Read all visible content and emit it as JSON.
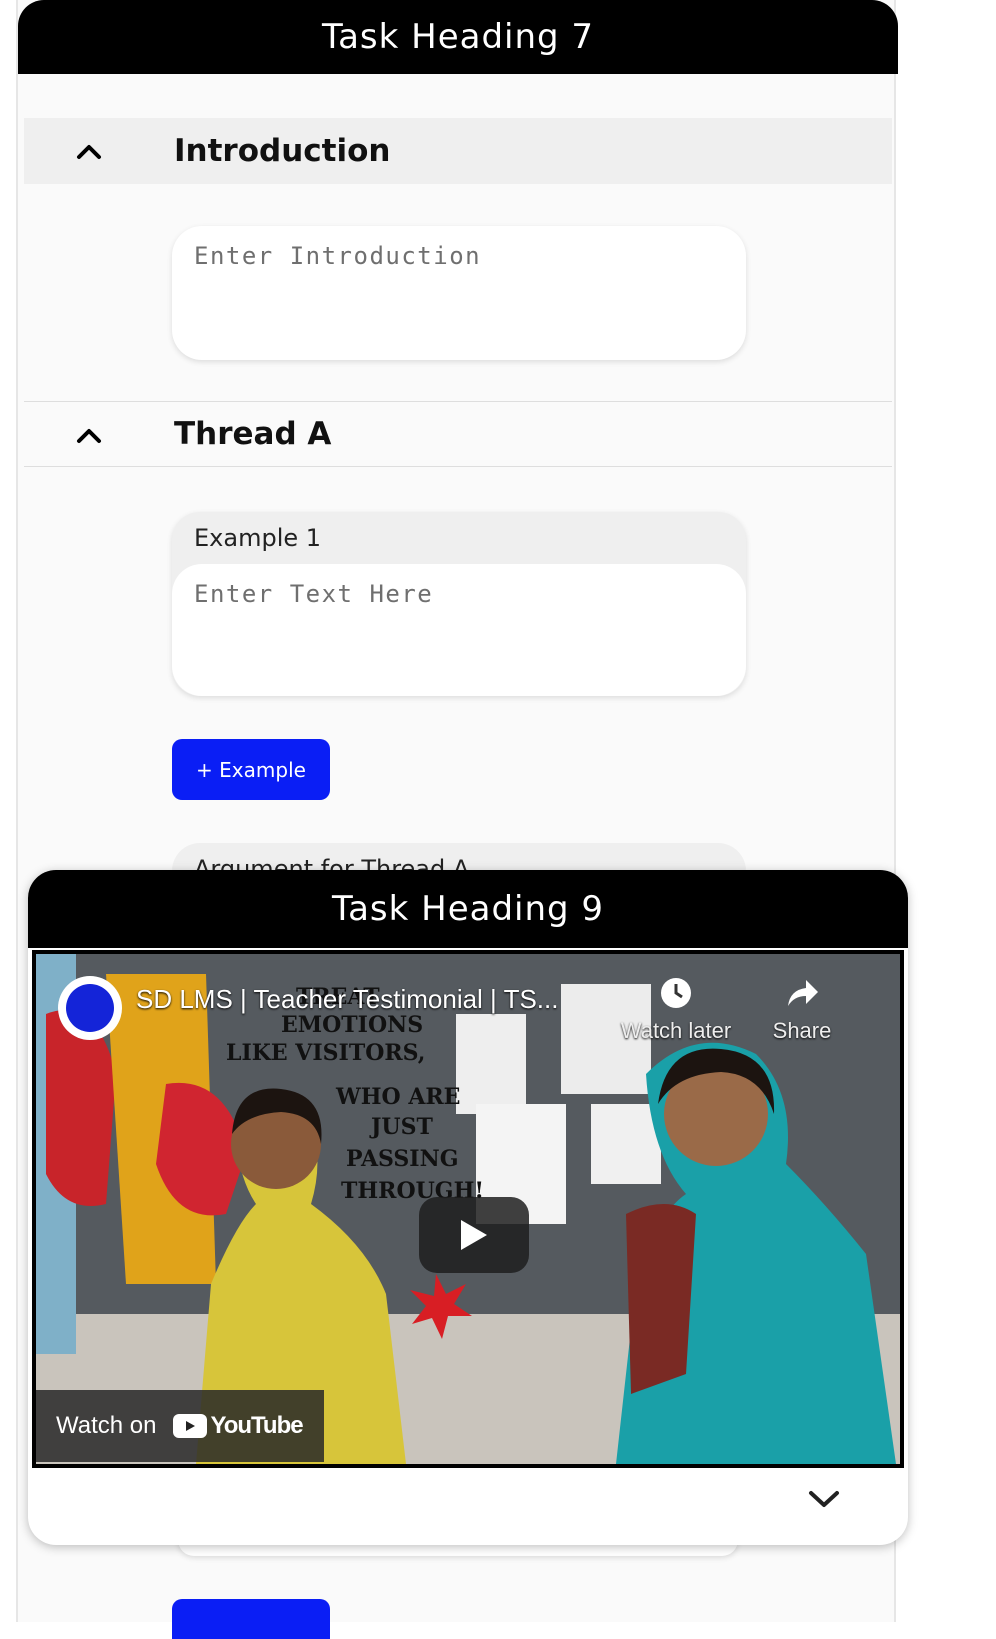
{
  "card1": {
    "heading": "Task Heading 7",
    "sections": [
      {
        "title": "Introduction",
        "placeholder": "Enter Introduction"
      },
      {
        "title": "Thread A"
      }
    ],
    "example": {
      "label": "Example 1",
      "placeholder": "Enter Text Here"
    },
    "add_example_label": "+ Example",
    "argument_label": "Argument for Thread A"
  },
  "card2": {
    "heading": "Task Heading 9",
    "video": {
      "title": "SD LMS | Teacher Testimonial | TS...",
      "watch_later": "Watch later",
      "share": "Share",
      "watch_on": "Watch on",
      "brand": "YouTube",
      "poster_text": [
        "TREAT",
        "EMOTIONS",
        "LIKE VISITORS,",
        "WHO ARE",
        "JUST",
        "PASSING",
        "THROUGH!"
      ]
    }
  },
  "icons": {
    "collapse": "chevron-up-icon",
    "expand": "chevron-down-icon",
    "play": "play-icon",
    "clock": "clock-icon",
    "share": "share-arrow-icon"
  },
  "colors": {
    "primary_button": "#0a1ef5",
    "header_bg": "#000000"
  }
}
